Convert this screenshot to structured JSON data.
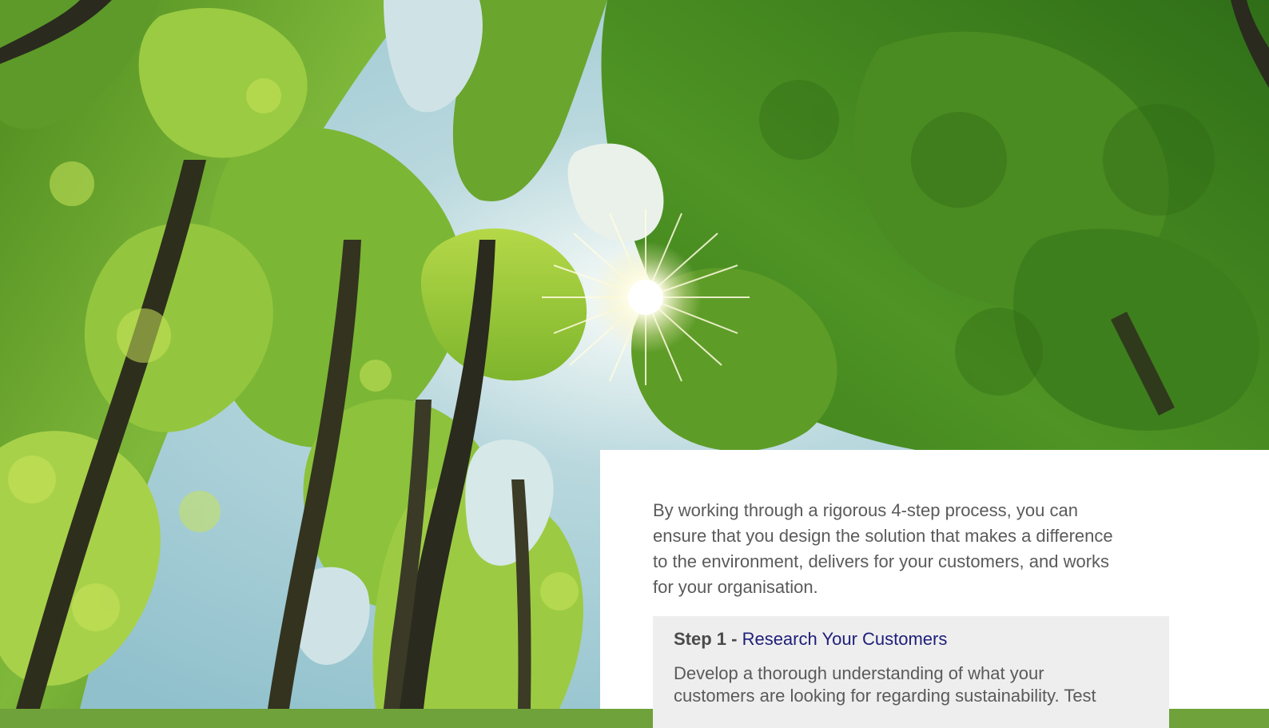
{
  "hero": {
    "icon": "forest-canopy-sunburst-image"
  },
  "content": {
    "intro": "By working through a rigorous 4-step process, you can ensure that you design the solution that makes a difference to the environment, delivers for your customers, and works for your organisation.",
    "step": {
      "label": "Step 1 - ",
      "link_text": "Research Your Customers",
      "body": "Develop a thorough understanding of what your customers are looking for regarding sustainability. Test"
    }
  },
  "colors": {
    "link": "#1e1e7a",
    "text": "#5a5a5a",
    "panel_bg": "#ffffff",
    "step_bg": "#eeeeee"
  }
}
